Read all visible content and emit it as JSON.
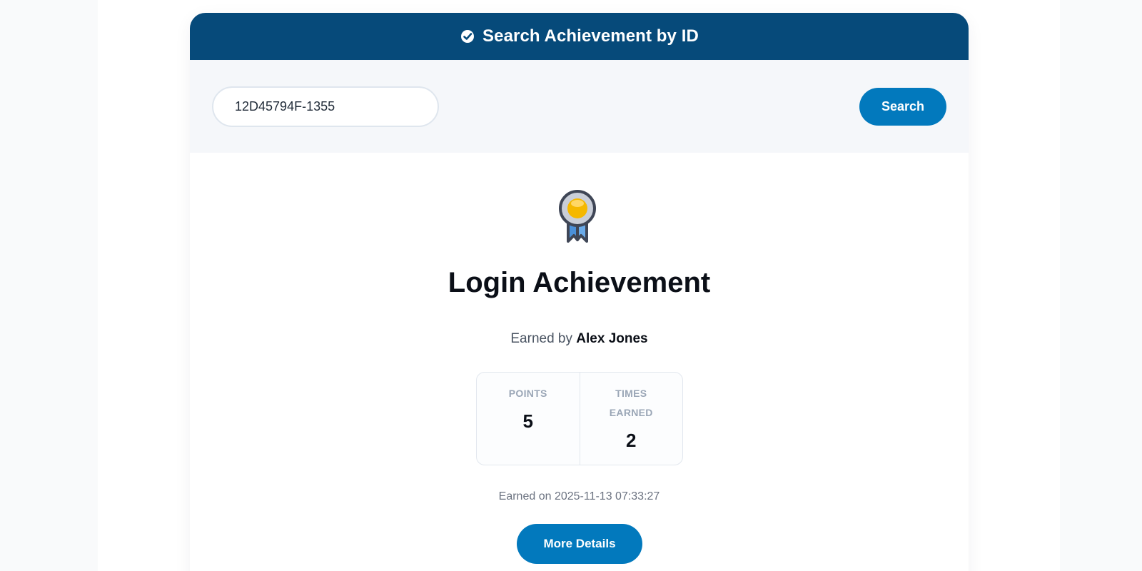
{
  "header": {
    "title": "Search Achievement by ID",
    "icon": "badge-check-icon"
  },
  "search": {
    "value": "12D45794F-1355",
    "button_label": "Search"
  },
  "achievement": {
    "icon": "medal-icon",
    "title": "Login Achievement",
    "earned_by_prefix": "Earned by",
    "earned_by_name": "Alex Jones",
    "points_label": "POINTS",
    "points_value": "5",
    "times_earned_label": "TIMES EARNED",
    "times_earned_value": "2",
    "earned_on": "Earned on 2025-11-13 07:33:27",
    "details_button_label": "More Details"
  },
  "colors": {
    "header_bg": "#064a7a",
    "accent": "#0279bd",
    "medal_gold": "#f5b800",
    "medal_ribbon": "#4a90d9"
  }
}
